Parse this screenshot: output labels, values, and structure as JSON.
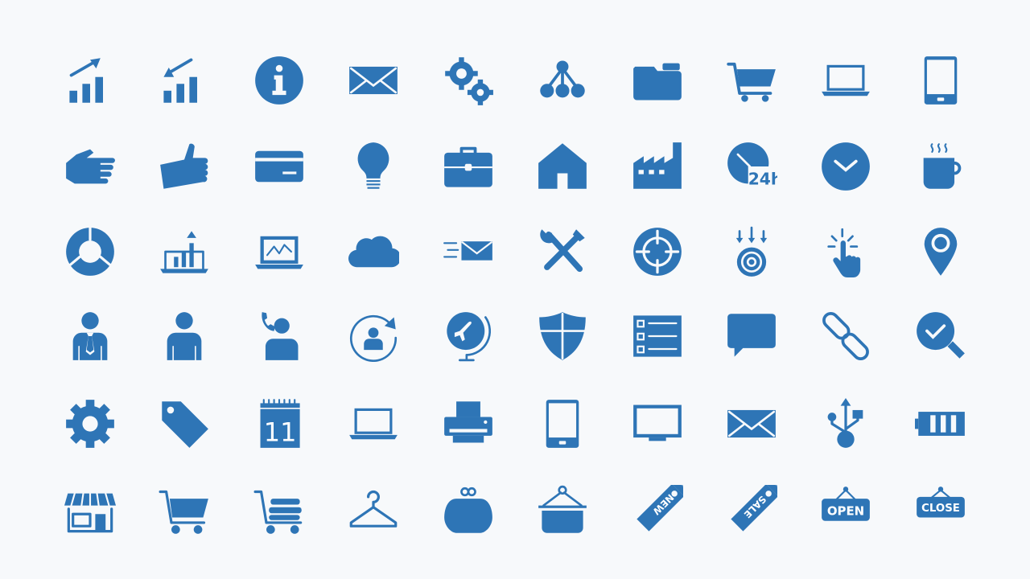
{
  "icon_color": "#2e75b6",
  "background": "#f7f9fb",
  "rows": [
    [
      "chart-up-icon",
      "chart-down-icon",
      "info-icon",
      "mail-icon",
      "gears-icon",
      "network-icon",
      "folder-icon",
      "cart-icon",
      "laptop-icon",
      "mobile-icon"
    ],
    [
      "hand-icon",
      "thumbs-up-icon",
      "credit-card-icon",
      "lightbulb-icon",
      "briefcase-icon",
      "home-icon",
      "factory-icon",
      "clock-24h-icon",
      "chevron-circle-icon",
      "coffee-icon"
    ],
    [
      "donut-chart-icon",
      "laptop-chart-icon",
      "laptop-graph-icon",
      "cloud-icon",
      "fast-mail-icon",
      "tools-icon",
      "crosshair-icon",
      "target-arrows-icon",
      "click-hand-icon",
      "map-pin-icon"
    ],
    [
      "businessman-icon",
      "user-icon",
      "user-phone-icon",
      "user-refresh-icon",
      "globe-plane-icon",
      "shield-icon",
      "checklist-icon",
      "chat-bubble-icon",
      "link-icon",
      "search-check-icon"
    ],
    [
      "gear-icon",
      "tag-icon",
      "calendar-icon",
      "laptop-icon",
      "printer-icon",
      "mobile-icon",
      "monitor-icon",
      "mail-icon",
      "usb-icon",
      "battery-icon"
    ],
    [
      "store-icon",
      "cart-icon",
      "cart-loaded-icon",
      "hanger-icon",
      "purse-icon",
      "basket-icon",
      "new-tag-icon",
      "sale-tag-icon",
      "open-sign-icon",
      "close-sign-icon"
    ]
  ],
  "labels": {
    "clock": "24h",
    "calendar": "11",
    "new": "NEW",
    "sale": "SALE",
    "open": "OPEN",
    "close": "CLOSE"
  }
}
